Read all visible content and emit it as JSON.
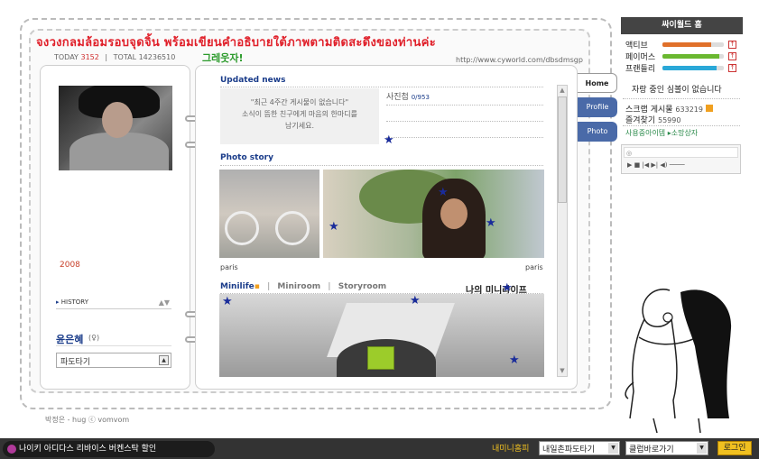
{
  "header": {
    "headline": "จงวงกลมล้อมรอบจุดจิ้น พร้อมเขียนคำอธิบายใต้ภาพตามติดสะดึงของท่านค่ะ",
    "subtitle": "그레웃자!",
    "today_label": "TODAY",
    "today_value": "3152",
    "total_label": "TOTAL",
    "total_value": "14236510",
    "url": "http://www.cyworld.com/dbsdmsgp"
  },
  "profile": {
    "year": "2008",
    "history_label": "HISTORY",
    "history_arrows": "▲▼",
    "name": "윤은혜",
    "gender": "(♀)",
    "pado_label": "파도타기",
    "pado_button": "▲"
  },
  "updated": {
    "title": "Updated news",
    "empty_line1": "\"최근 4주간 게시물이 없습니다\"",
    "empty_line2": "소식이 뜸한 친구에게 마음의 한마디를",
    "empty_line3": "남기세요.",
    "photo_label": "사진첩",
    "photo_count": "0/953"
  },
  "photostory": {
    "title": "Photo story",
    "captions": [
      "paris",
      "paris"
    ]
  },
  "minilife": {
    "tabs": [
      "Minilife",
      "Miniroom",
      "Storyroom"
    ],
    "separator": "|",
    "room_title": "나의 미니라이프"
  },
  "tabs": [
    "Home",
    "Profile",
    "Photo"
  ],
  "cyworld": {
    "title": "싸이월드 홈",
    "stats": [
      {
        "label": "액티브",
        "fill": 0.8,
        "color": "#e0702a"
      },
      {
        "label": "페이머스",
        "fill": 0.92,
        "color": "#6ab830"
      },
      {
        "label": "프랜들리",
        "fill": 0.88,
        "color": "#2aa8d8"
      }
    ],
    "plus": "↑",
    "no_heart": "자랑 중인 심볼이 없습니다",
    "scrap_label": "스크랩 게시물",
    "scrap_value": "633219",
    "fav_label": "즐겨찾기",
    "fav_value": "55990",
    "items_label": "사용중아이템 ▸소망상자",
    "player_controls": "▶ ■ |◀ ▶| ◀) ────"
  },
  "footer": {
    "signature": "박정은 - hug ⓒ vomvom",
    "ad_text": "나이키 아디다스 리바이스 버켄스탁 할인",
    "my_mini": "내미니홈피",
    "select1": "내일촌파도타기",
    "select2": "클럽바로가기",
    "login": "로그인"
  }
}
